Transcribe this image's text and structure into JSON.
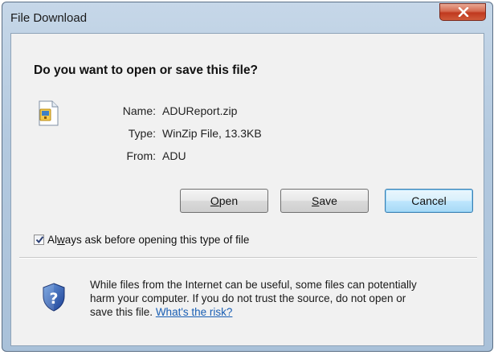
{
  "window": {
    "title": "File Download"
  },
  "dialog": {
    "heading": "Do you want to open or save this file?",
    "file": {
      "name_label": "Name:",
      "name_value": "ADUReport.zip",
      "type_label": "Type:",
      "type_value": "WinZip File, 13.3KB",
      "from_label": "From:",
      "from_value": "ADU"
    },
    "buttons": {
      "open": {
        "first": "O",
        "rest": "pen"
      },
      "save": {
        "first": "S",
        "rest": "ave"
      },
      "cancel": "Cancel"
    },
    "checkbox": {
      "checked": true,
      "label_before": "Al",
      "label_mnemonic": "w",
      "label_after": "ays ask before opening this type of file"
    },
    "warning": {
      "line1": "While files from the Internet can be useful, some files can potentially",
      "line2": "harm your computer. If you do not trust the source, do not open or",
      "line3": "save this file.",
      "link": "What's the risk?"
    }
  },
  "icons": {
    "file": "winzip-file-icon",
    "shield": "security-shield-question-icon",
    "close": "close-icon",
    "check": "checkmark-icon"
  },
  "colors": {
    "titlebar": "#b3c9df",
    "close_button": "#c0391f",
    "link": "#1a5fb4",
    "default_button_border": "#3c7fb1"
  }
}
